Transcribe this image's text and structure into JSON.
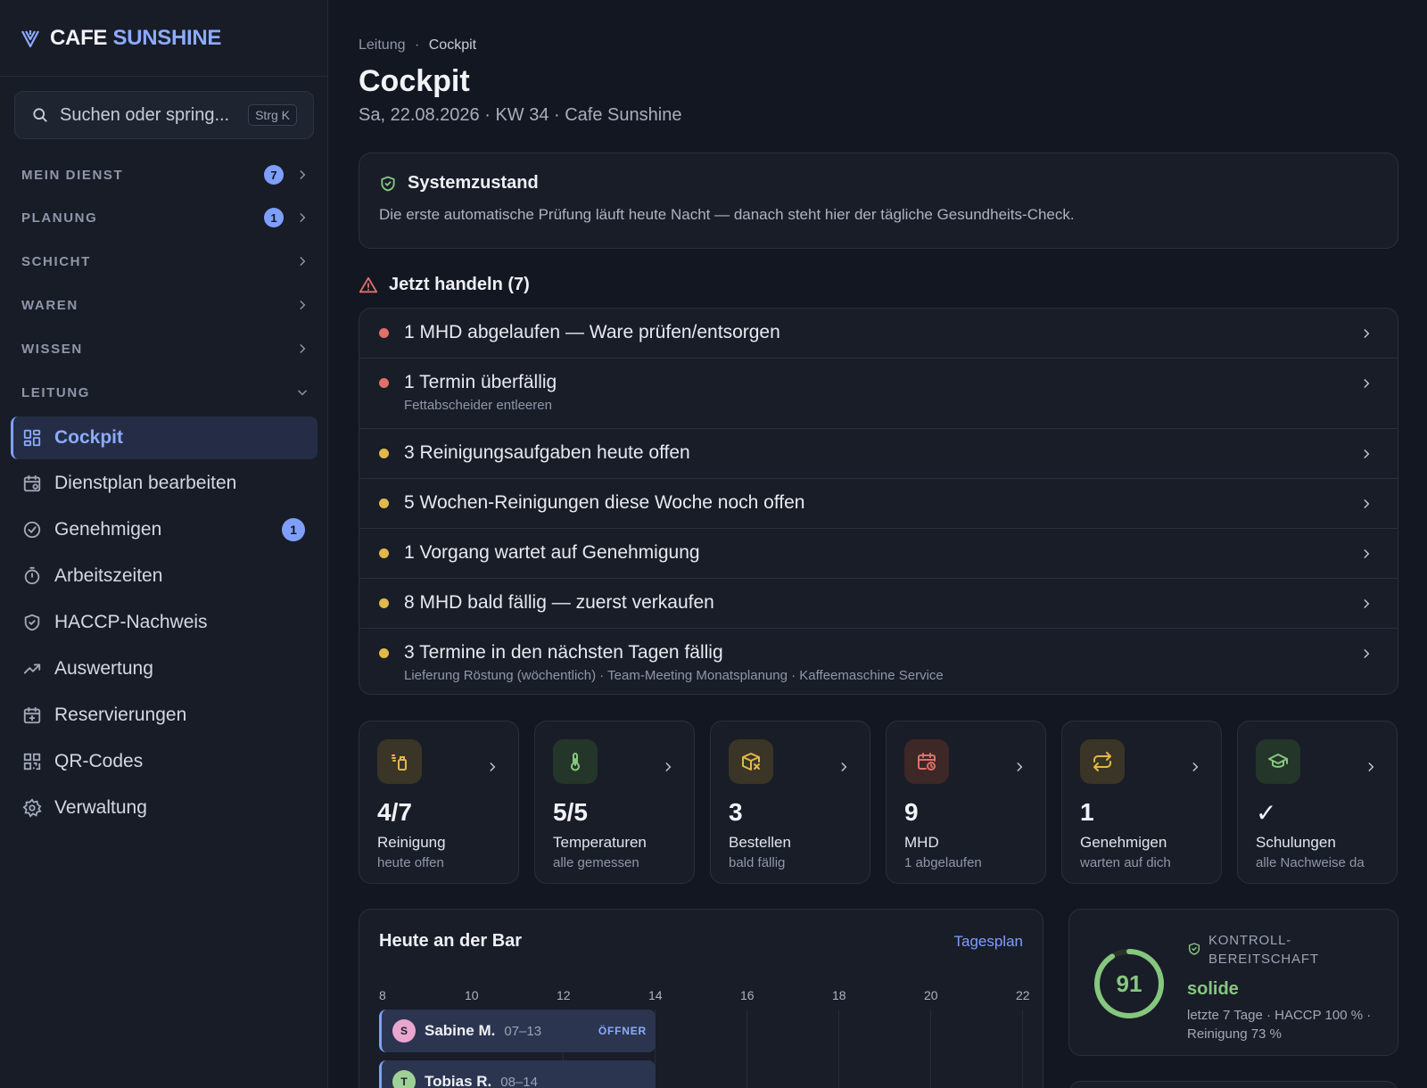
{
  "brand": {
    "part1": "CAFE",
    "part2": "SUNSHINE"
  },
  "search": {
    "placeholder": "Suchen oder spring...",
    "shortcut": "Strg K"
  },
  "sections": [
    {
      "label": "MEIN DIENST",
      "badge": "7"
    },
    {
      "label": "PLANUNG",
      "badge": "1"
    },
    {
      "label": "SCHICHT",
      "badge": ""
    },
    {
      "label": "WAREN",
      "badge": ""
    },
    {
      "label": "WISSEN",
      "badge": ""
    },
    {
      "label": "LEITUNG",
      "badge": ""
    }
  ],
  "nav": [
    {
      "label": "Cockpit",
      "icon": "dashboard-icon",
      "active": true
    },
    {
      "label": "Dienstplan bearbeiten",
      "icon": "calendar-edit-icon"
    },
    {
      "label": "Genehmigen",
      "icon": "check-circle-icon",
      "badge": "1"
    },
    {
      "label": "Arbeitszeiten",
      "icon": "stopwatch-icon"
    },
    {
      "label": "HACCP-Nachweis",
      "icon": "shield-check-icon"
    },
    {
      "label": "Auswertung",
      "icon": "trend-up-icon"
    },
    {
      "label": "Reservierungen",
      "icon": "calendar-plus-icon"
    },
    {
      "label": "QR-Codes",
      "icon": "qr-code-icon"
    },
    {
      "label": "Verwaltung",
      "icon": "gear-icon"
    }
  ],
  "breadcrumb": {
    "parent": "Leitung",
    "sep": "·",
    "current": "Cockpit"
  },
  "page": {
    "title": "Cockpit",
    "subtitle": "Sa, 22.08.2026 · KW 34 · Cafe Sunshine"
  },
  "system": {
    "title": "Systemzustand",
    "text": "Die erste automatische Prüfung läuft heute Nacht — danach steht hier der tägliche Gesundheits-Check."
  },
  "actions_header": "Jetzt handeln (7)",
  "actions": [
    {
      "title": "1 MHD abgelaufen — Ware prüfen/entsorgen",
      "sub": "",
      "severity": "red"
    },
    {
      "title": "1 Termin überfällig",
      "sub": "Fettabscheider entleeren",
      "severity": "red"
    },
    {
      "title": "3 Reinigungsaufgaben heute offen",
      "sub": "",
      "severity": "yellow"
    },
    {
      "title": "5 Wochen-Reinigungen diese Woche noch offen",
      "sub": "",
      "severity": "yellow"
    },
    {
      "title": "1 Vorgang wartet auf Genehmigung",
      "sub": "",
      "severity": "yellow"
    },
    {
      "title": "8 MHD bald fällig — zuerst verkaufen",
      "sub": "",
      "severity": "yellow"
    },
    {
      "title": "3 Termine in den nächsten Tagen fällig",
      "sub": "Lieferung Röstung (wöchentlich) · Team-Meeting Monatsplanung · Kaffeemaschine Service",
      "severity": "yellow"
    }
  ],
  "colors": {
    "red": "#e07068",
    "yellow": "#e2b84a",
    "accent": "#7f9fff",
    "green": "#86c77f"
  },
  "kpis": [
    {
      "value": "4/7",
      "label": "Reinigung",
      "sub": "heute offen",
      "icon": "spray-bottle-icon"
    },
    {
      "value": "5/5",
      "label": "Temperaturen",
      "sub": "alle gemessen",
      "icon": "thermometer-icon"
    },
    {
      "value": "3",
      "label": "Bestellen",
      "sub": "bald fällig",
      "icon": "package-x-icon"
    },
    {
      "value": "9",
      "label": "MHD",
      "sub": "1 abgelaufen",
      "icon": "calendar-clock-icon"
    },
    {
      "value": "1",
      "label": "Genehmigen",
      "sub": "warten auf dich",
      "icon": "repeat-arrows-icon"
    },
    {
      "value": "✓",
      "label": "Schulungen",
      "sub": "alle Nachweise da",
      "icon": "graduation-cap-icon"
    }
  ],
  "bar": {
    "title": "Heute an der Bar",
    "link": "Tagesplan",
    "hours": [
      "8",
      "10",
      "12",
      "14",
      "16",
      "18",
      "20",
      "22"
    ],
    "shifts": [
      {
        "initial": "S",
        "name": "Sabine M.",
        "time": "07–13",
        "tag": "ÖFFNER"
      },
      {
        "initial": "T",
        "name": "Tobias R.",
        "time": "08–14",
        "tag": ""
      }
    ]
  },
  "readiness": {
    "score": "91",
    "score_fraction": 0.91,
    "label": "KONTROLL-BEREITSCHAFT",
    "value": "solide",
    "sub": "letzte 7 Tage · HACCP 100 % · Reinigung 73 %"
  }
}
